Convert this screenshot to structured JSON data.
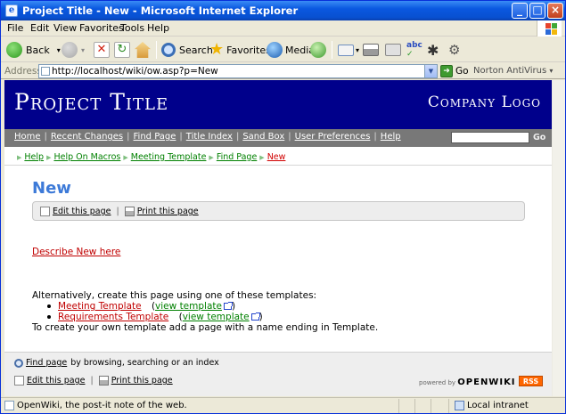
{
  "window": {
    "title": "Project Title - New - Microsoft Internet Explorer",
    "min": "_",
    "max": "□",
    "close": "×"
  },
  "menu": [
    "File",
    "Edit",
    "View",
    "Favorites",
    "Tools",
    "Help"
  ],
  "toolbar": {
    "back": "Back",
    "search": "Search",
    "favorites": "Favorites",
    "media": "Media"
  },
  "address": {
    "label": "Address",
    "url": "http://localhost/wiki/ow.asp?p=New",
    "go": "Go",
    "norton": "Norton AntiVirus"
  },
  "site": {
    "project_title": "Project Title",
    "company_logo": "Company Logo"
  },
  "nav": {
    "links": [
      "Home",
      "Recent Changes",
      "Find Page",
      "Title Index",
      "Sand Box",
      "User Preferences",
      "Help"
    ],
    "go": "Go"
  },
  "breadcrumbs": [
    "Help",
    "Help On Macros",
    "Meeting Template",
    "Find Page",
    "New"
  ],
  "page": {
    "title": "New",
    "edit": "Edit this page",
    "print": "Print this page",
    "describe": "Describe New here",
    "alt_text": "Alternatively, create this page using one of these templates:",
    "templates": [
      {
        "name": "Meeting Template",
        "view": "view template"
      },
      {
        "name": "Requirements Template",
        "view": "view template"
      }
    ],
    "own_template": "To create your own template add a page with a name ending in Template."
  },
  "footer": {
    "find": "Find page",
    "find_rest": "by browsing, searching or an index",
    "edit": "Edit this page",
    "print": "Print this page",
    "powered": "powered by",
    "brand": "OPENWIKI",
    "rss": "RSS"
  },
  "status": {
    "text": "OpenWiki, the post-it note of the web.",
    "zone": "Local intranet"
  }
}
